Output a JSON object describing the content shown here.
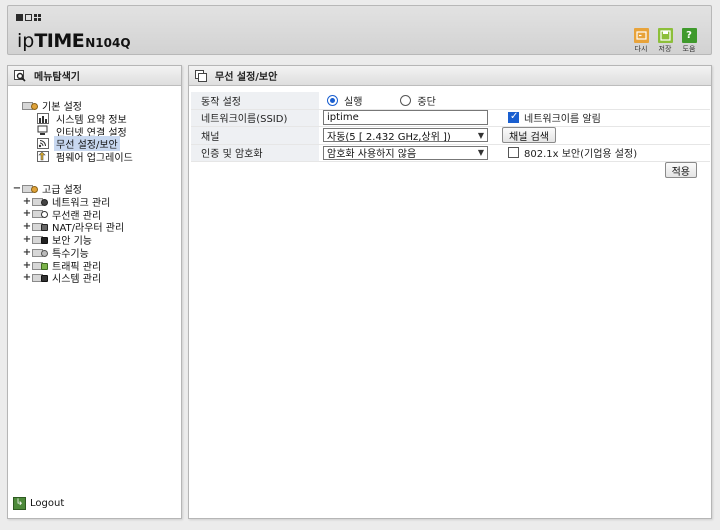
{
  "header": {
    "brand_ip": "ip",
    "brand_time": "TIME",
    "brand_model": "N104Q",
    "buttons": [
      {
        "label": "다시",
        "icon": "reload-icon",
        "color": "#e8a33a"
      },
      {
        "label": "저장",
        "icon": "save-icon",
        "color": "#8cbf3a"
      },
      {
        "label": "도움",
        "icon": "help-icon",
        "color": "#3f9a2c"
      }
    ]
  },
  "sidebar": {
    "title": "메뉴탐색기",
    "basic": {
      "label": "기본 설정",
      "items": [
        {
          "label": "시스템 요약 정보",
          "icon": "chart-icon"
        },
        {
          "label": "인터넷 연결 설정",
          "icon": "monitor-icon"
        },
        {
          "label": "무선 설정/보안",
          "icon": "wireless-icon",
          "selected": true
        },
        {
          "label": "펌웨어 업그레이드",
          "icon": "upgrade-icon"
        }
      ]
    },
    "advanced": {
      "label": "고급 설정",
      "items": [
        {
          "label": "네트워크 관리",
          "icon": "network-icon"
        },
        {
          "label": "무선랜 관리",
          "icon": "wireless-icon"
        },
        {
          "label": "NAT/라우터 관리",
          "icon": "router-icon"
        },
        {
          "label": "보안 기능",
          "icon": "lock-icon"
        },
        {
          "label": "특수기능",
          "icon": "special-icon"
        },
        {
          "label": "트래픽 관리",
          "icon": "traffic-icon"
        },
        {
          "label": "시스템 관리",
          "icon": "system-icon"
        }
      ]
    },
    "logout": "Logout"
  },
  "main": {
    "title": "무선 설정/보안",
    "rows": {
      "operation": {
        "label": "동작 설정",
        "options": [
          "실행",
          "중단"
        ],
        "selected": "실행"
      },
      "ssid": {
        "label": "네트워크이름(SSID)",
        "value": "iptime",
        "checkbox_label": "네트워크이름 알림",
        "checked": true
      },
      "channel": {
        "label": "채널",
        "value": "자동(5 [ 2.432 GHz,상위 ])",
        "button": "채널 검색"
      },
      "auth": {
        "label": "인증 및 암호화",
        "value": "암호화 사용하지 않음",
        "checkbox_label": "802.1x 보안(기업용 설정)",
        "checked": false
      }
    },
    "apply": "적용"
  }
}
